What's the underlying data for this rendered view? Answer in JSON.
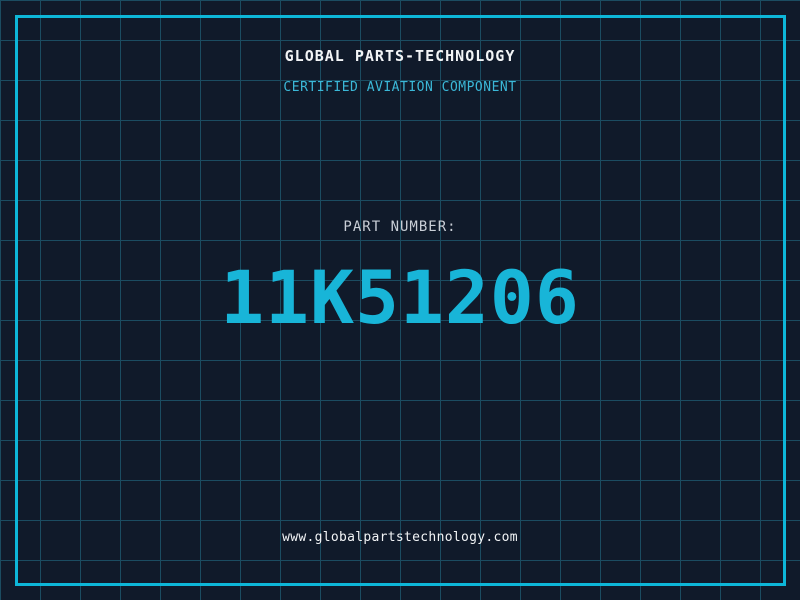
{
  "header": {
    "title": "GLOBAL PARTS-TECHNOLOGY",
    "subtitle": "CERTIFIED AVIATION COMPONENT"
  },
  "part": {
    "label": "PART NUMBER:",
    "number": "11K51206"
  },
  "footer": {
    "website": "www.globalpartstechnology.com"
  },
  "colors": {
    "background": "#101a2a",
    "grid_line": "#1b4c61",
    "frame_cyan": "#0db6d8",
    "number_cyan": "#18b5d8",
    "subtitle_cyan": "#3bb8d8",
    "title_white": "#f2f4f6",
    "label_gray": "#c9ced6"
  }
}
